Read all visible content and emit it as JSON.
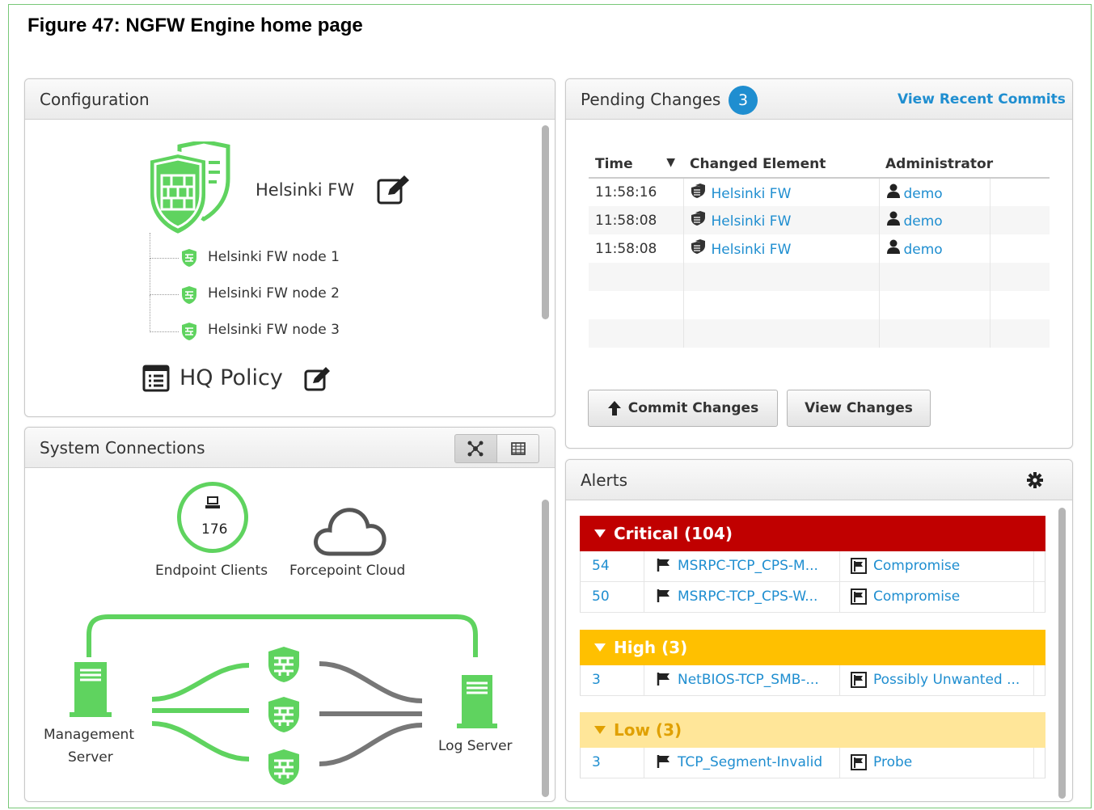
{
  "figure_title": "Figure 47: NGFW Engine home page",
  "colors": {
    "green": "#5fd35f",
    "link": "#1f8ed0",
    "critical": "#c00000",
    "high": "#ffc000",
    "low": "#ffe699",
    "badge": "#1f8ed0"
  },
  "configuration": {
    "title": "Configuration",
    "engine_name": "Helsinki FW",
    "nodes": [
      "Helsinki FW node 1",
      "Helsinki FW node 2",
      "Helsinki FW node 3"
    ],
    "policy_name": "HQ Policy"
  },
  "pending_changes": {
    "title": "Pending Changes",
    "count": "3",
    "view_recent_commits": "View Recent Commits",
    "columns": {
      "time": "Time",
      "changed_element": "Changed Element",
      "administrator": "Administrator"
    },
    "rows": [
      {
        "time": "11:58:16",
        "element": "Helsinki FW",
        "admin": "demo"
      },
      {
        "time": "11:58:08",
        "element": "Helsinki FW",
        "admin": "demo"
      },
      {
        "time": "11:58:08",
        "element": "Helsinki FW",
        "admin": "demo"
      }
    ],
    "commit_label": "Commit Changes",
    "view_changes_label": "View Changes"
  },
  "system_connections": {
    "title": "System Connections",
    "endpoint_count": "176",
    "endpoint_label": "Endpoint Clients",
    "cloud_label": "Forcepoint Cloud",
    "management_label_1": "Management",
    "management_label_2": "Server",
    "log_label": "Log Server"
  },
  "alerts": {
    "title": "Alerts",
    "critical": {
      "label": "Critical (104)",
      "rows": [
        {
          "count": "54",
          "name": "MSRPC-TCP_CPS-M...",
          "category": "Compromise"
        },
        {
          "count": "50",
          "name": "MSRPC-TCP_CPS-W...",
          "category": "Compromise"
        }
      ]
    },
    "high": {
      "label": "High (3)",
      "rows": [
        {
          "count": "3",
          "name": "NetBIOS-TCP_SMB-...",
          "category": "Possibly Unwanted ..."
        }
      ]
    },
    "low": {
      "label": "Low (3)",
      "rows": [
        {
          "count": "3",
          "name": "TCP_Segment-Invalid",
          "category": "Probe"
        }
      ]
    }
  }
}
